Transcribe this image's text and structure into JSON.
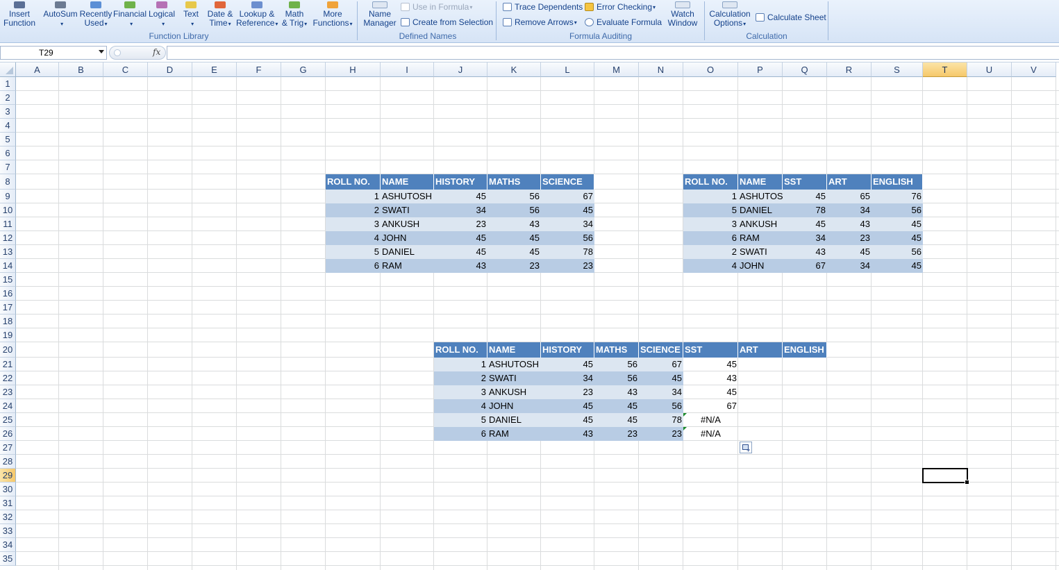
{
  "ribbon": {
    "function_library": {
      "label": "Function Library",
      "buttons": [
        {
          "name": "insert-function",
          "line1": "Insert",
          "line2": "Function",
          "dropdown": false
        },
        {
          "name": "autosum",
          "line1": "AutoSum",
          "line2": "",
          "dropdown": true
        },
        {
          "name": "recently-used",
          "line1": "Recently",
          "line2": "Used",
          "dropdown": true
        },
        {
          "name": "financial",
          "line1": "Financial",
          "line2": "",
          "dropdown": true
        },
        {
          "name": "logical",
          "line1": "Logical",
          "line2": "",
          "dropdown": true
        },
        {
          "name": "text",
          "line1": "Text",
          "line2": "",
          "dropdown": true
        },
        {
          "name": "date-time",
          "line1": "Date &",
          "line2": "Time",
          "dropdown": true
        },
        {
          "name": "lookup-reference",
          "line1": "Lookup &",
          "line2": "Reference",
          "dropdown": true
        },
        {
          "name": "math-trig",
          "line1": "Math",
          "line2": "& Trig",
          "dropdown": true
        },
        {
          "name": "more-functions",
          "line1": "More",
          "line2": "Functions",
          "dropdown": true
        }
      ]
    },
    "defined_names": {
      "label": "Defined Names",
      "name_manager_1": "Name",
      "name_manager_2": "Manager",
      "use_in_formula": "Use in Formula",
      "create_from_selection": "Create from Selection"
    },
    "formula_auditing": {
      "label": "Formula Auditing",
      "trace_dependents": "Trace Dependents",
      "remove_arrows": "Remove Arrows",
      "error_checking": "Error Checking",
      "evaluate_formula": "Evaluate Formula",
      "watch_window_1": "Watch",
      "watch_window_2": "Window"
    },
    "calculation": {
      "label": "Calculation",
      "calc_options_1": "Calculation",
      "calc_options_2": "Options",
      "calculate_sheet": "Calculate Sheet"
    },
    "icon_colors": {
      "insert-function": "#5a6f96",
      "autosum": "#6b7a92",
      "recently-used": "#5b8fd6",
      "financial": "#6fb24a",
      "logical": "#b571b5",
      "text": "#e7c84a",
      "date-time": "#e0663a",
      "lookup-reference": "#6c8fcf",
      "math-trig": "#6fb24a",
      "more-functions": "#f0a33a"
    }
  },
  "formula_bar": {
    "name_box": "T29",
    "fx": "fx",
    "formula": ""
  },
  "sheet": {
    "columns": [
      "A",
      "B",
      "C",
      "D",
      "E",
      "F",
      "G",
      "H",
      "I",
      "J",
      "K",
      "L",
      "M",
      "N",
      "O",
      "P",
      "Q",
      "R",
      "S",
      "T",
      "U",
      "V"
    ],
    "selected_column": "T",
    "selected_row": 29,
    "rows": [
      1,
      2,
      3,
      4,
      5,
      6,
      7,
      8,
      9,
      10,
      11,
      12,
      13,
      14,
      15,
      16,
      17,
      18,
      19,
      20,
      21,
      22,
      23,
      24,
      25,
      26,
      27,
      28,
      29,
      30,
      31,
      32,
      33,
      34,
      35
    ],
    "table1": {
      "headers": [
        "ROLL NO.",
        "NAME",
        "HISTORY",
        "MATHS",
        "SCIENCE"
      ],
      "rows": [
        [
          "1",
          "ASHUTOSH",
          "45",
          "56",
          "67"
        ],
        [
          "2",
          "SWATI",
          "34",
          "56",
          "45"
        ],
        [
          "3",
          "ANKUSH",
          "23",
          "43",
          "34"
        ],
        [
          "4",
          "JOHN",
          "45",
          "45",
          "56"
        ],
        [
          "5",
          "DANIEL",
          "45",
          "45",
          "78"
        ],
        [
          "6",
          "RAM",
          "43",
          "23",
          "23"
        ]
      ]
    },
    "table2": {
      "headers": [
        "ROLL NO.",
        "NAME",
        "SST",
        "ART",
        "ENGLISH"
      ],
      "rows": [
        [
          "1",
          "ASHUTOSH",
          "45",
          "65",
          "76"
        ],
        [
          "5",
          "DANIEL",
          "78",
          "34",
          "56"
        ],
        [
          "3",
          "ANKUSH",
          "45",
          "43",
          "45"
        ],
        [
          "6",
          "RAM",
          "34",
          "23",
          "45"
        ],
        [
          "2",
          "SWATI",
          "43",
          "45",
          "56"
        ],
        [
          "4",
          "JOHN",
          "67",
          "34",
          "45"
        ]
      ]
    },
    "table3": {
      "headers": [
        "ROLL NO.",
        "NAME",
        "HISTORY",
        "MATHS",
        "SCIENCE",
        "SST",
        "ART",
        "ENGLISH"
      ],
      "rows": [
        [
          "1",
          "ASHUTOSH",
          "45",
          "56",
          "67",
          "45"
        ],
        [
          "2",
          "SWATI",
          "34",
          "56",
          "45",
          "43"
        ],
        [
          "3",
          "ANKUSH",
          "23",
          "43",
          "34",
          "45"
        ],
        [
          "4",
          "JOHN",
          "45",
          "45",
          "56",
          "67"
        ],
        [
          "5",
          "DANIEL",
          "45",
          "45",
          "78",
          "#N/A"
        ],
        [
          "6",
          "RAM",
          "43",
          "23",
          "23",
          "#N/A"
        ]
      ]
    },
    "colors": {
      "header_fill": "#4f81bd",
      "band_light": "#dce6f1",
      "band_dark": "#b8cce4",
      "selection_header": "#f6c86a",
      "error_triangle": "#1a8a2a"
    }
  }
}
